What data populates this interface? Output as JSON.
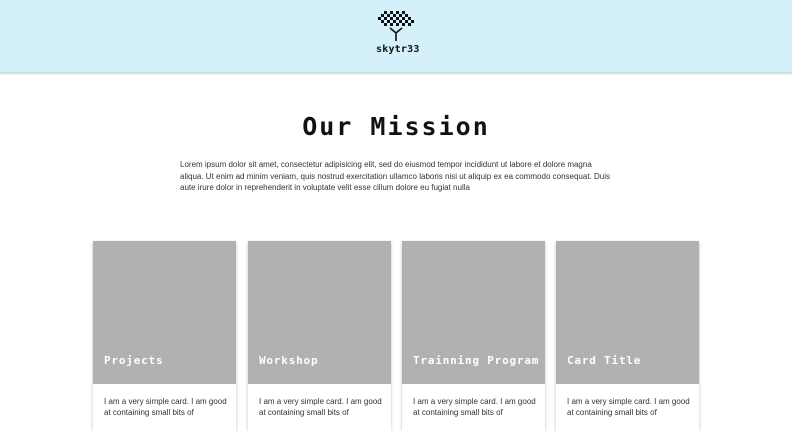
{
  "header": {
    "logo_text": "skytr33",
    "logo_icon": "tree-logo-icon"
  },
  "mission": {
    "title": "Our Mission",
    "body": "Lorem ipsum dolor sit amet, consectetur adipisicing elit, sed do eiusmod tempor incididunt ut labore et dolore magna aliqua. Ut enim ad minim veniam, quis nostrud exercitation ullamco laboris nisi ut aliquip ex ea commodo consequat. Duis aute irure dolor in reprehenderit in voluptate velit esse cillum dolore eu fugiat nulla"
  },
  "cards": [
    {
      "title": "Projects",
      "text": "I am a very simple card. I am good at containing small bits of"
    },
    {
      "title": "Workshop",
      "text": "I am a very simple card. I am good at containing small bits of"
    },
    {
      "title": "Trainning Program",
      "text": "I am a very simple card. I am good at containing small bits of"
    },
    {
      "title": "Card Title",
      "text": "I am a very simple card. I am good at containing small bits of"
    }
  ],
  "colors": {
    "header_bg": "#d4f0f9",
    "card_image": "#b1b1b1",
    "text": "#333333"
  }
}
